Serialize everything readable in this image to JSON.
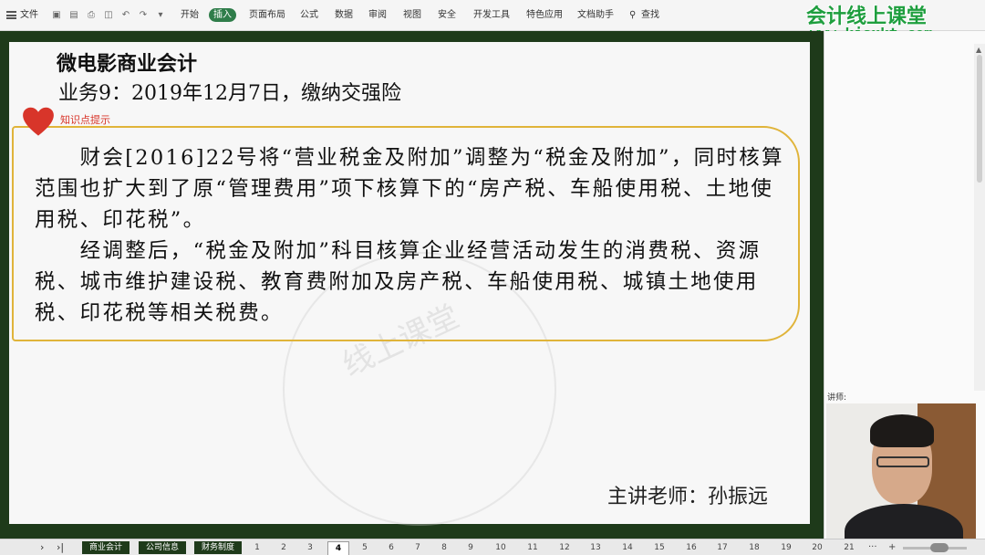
{
  "ribbon": {
    "file_label": "文件",
    "tabs": [
      "开始",
      "插入",
      "页面布局",
      "公式",
      "数据",
      "审阅",
      "视图",
      "安全",
      "开发工具",
      "特色应用",
      "文档助手"
    ],
    "active_tab": "插入",
    "search_label": "查找",
    "dropdown_glyph": "▾"
  },
  "watermark": {
    "title": "会计线上课堂",
    "url": "www.kjsxkt.com"
  },
  "slide": {
    "title": "微电影商业会计",
    "subtitle": "业务9：2019年12月7日，缴纳交强险",
    "tip_label": "知识点提示",
    "paragraph_1": "　　财会[2016]22号将“营业税金及附加”调整为“税金及附加”，同时核算范围也扩大到了原“管理费用”项下核算下的“房产税、车船使用税、土地使用税、印花税”。",
    "paragraph_2": "　　经调整后，“税金及附加”科目核算企业经营活动发生的消费税、资源税、城市维护建设税、教育费附加及房产税、车船使用税、城镇土地使用税、印花税等相关税费。",
    "ghost_text": "线上课堂",
    "presenter": "主讲老师：孙振远"
  },
  "panel": {
    "lecturer_label": "讲师:"
  },
  "bottombar": {
    "nav_next": "›",
    "nav_last": "›|",
    "sheets": [
      "商业会计",
      "公司信息",
      "财务制度"
    ],
    "pages": [
      "1",
      "2",
      "3",
      "4",
      "5",
      "6",
      "7",
      "8",
      "9",
      "10",
      "11",
      "12",
      "13",
      "14",
      "15",
      "16",
      "17",
      "18",
      "19",
      "20",
      "21"
    ],
    "current_page": "4",
    "more": "···",
    "zoom_in": "+"
  },
  "colors": {
    "accent_green": "#2f7d4a",
    "slide_frame": "#1e3a1a",
    "note_border": "#e0b43a",
    "heart": "#d8352a"
  }
}
